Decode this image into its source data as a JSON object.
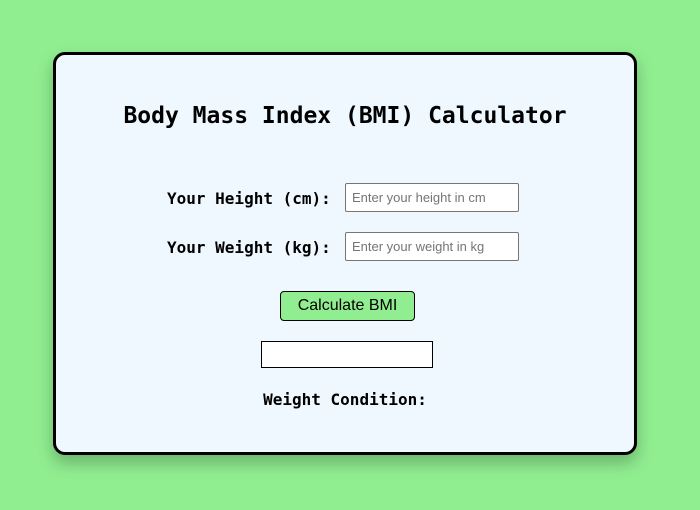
{
  "app": {
    "title": "Body Mass Index (BMI) Calculator"
  },
  "form": {
    "height_label": "Your Height (cm):",
    "height_value": "",
    "height_placeholder": "Enter your height in cm",
    "weight_label": "Your Weight (kg):",
    "weight_value": "",
    "weight_placeholder": "Enter your weight in kg",
    "calculate_label": "Calculate BMI"
  },
  "result": {
    "bmi_value": "",
    "condition_label": "Weight Condition:",
    "condition_value": ""
  },
  "colors": {
    "page_background": "#90ee90",
    "card_background": "#f0f8ff",
    "button_background": "#90ee90"
  }
}
